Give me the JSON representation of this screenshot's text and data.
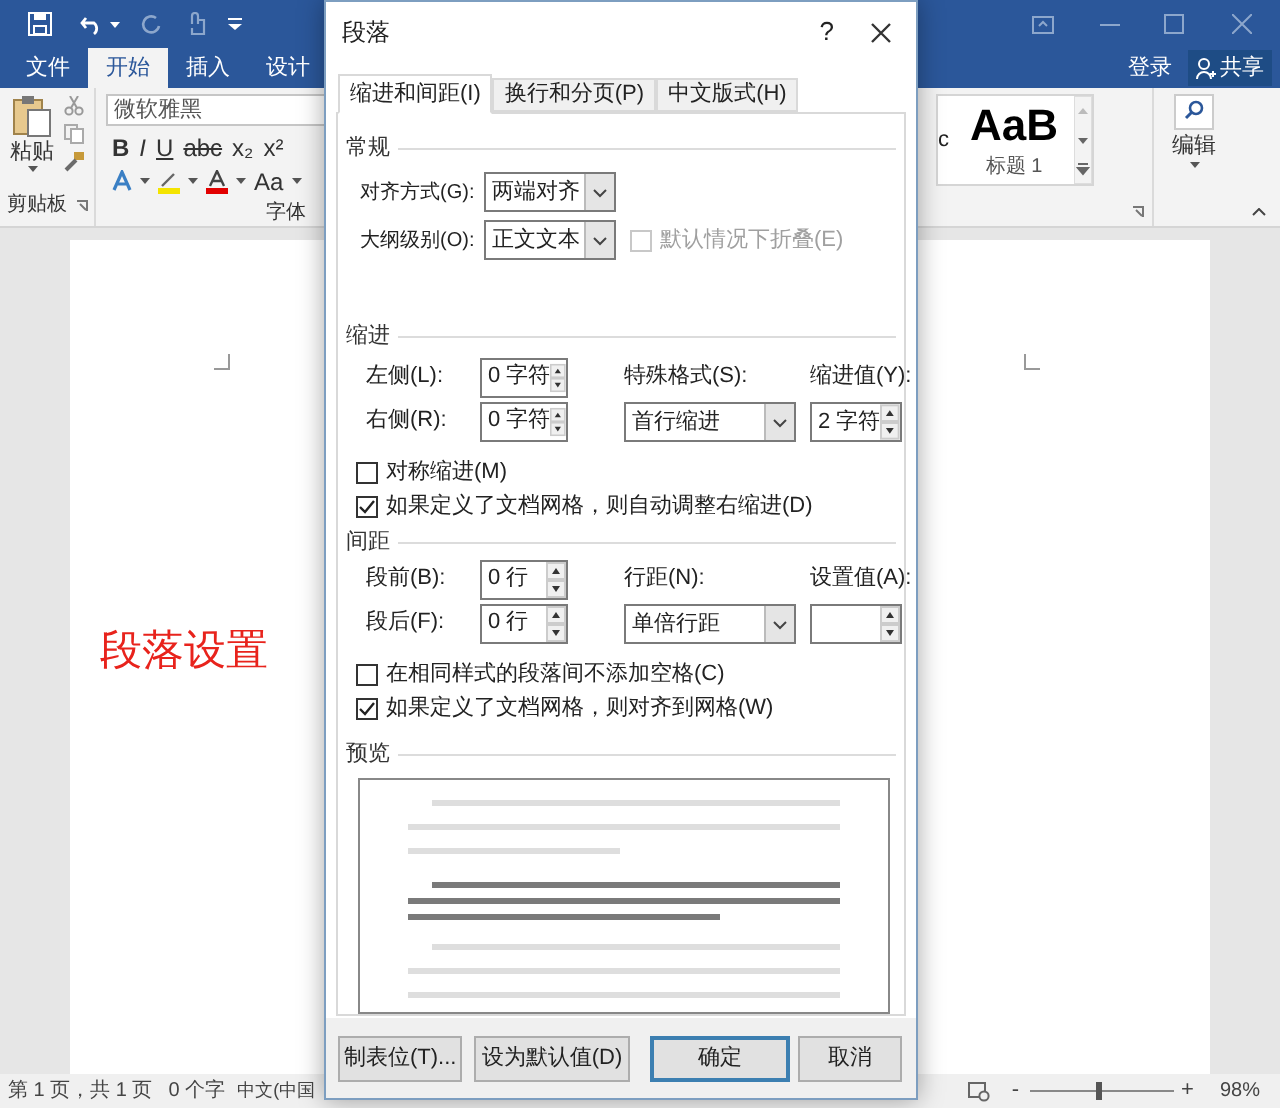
{
  "ribbon_tabs": [
    {
      "label": "文件",
      "selected": false
    },
    {
      "label": "开始",
      "selected": true
    },
    {
      "label": "插入",
      "selected": false
    },
    {
      "label": "设计",
      "selected": false
    }
  ],
  "account": {
    "sign_in": "登录",
    "share": "共享"
  },
  "ribbon": {
    "clipboard": {
      "paste": "粘贴",
      "group": "剪贴板"
    },
    "font": {
      "font_name": "微软雅黑",
      "group": "字体",
      "format_buttons": [
        "B",
        "I",
        "U",
        "abc",
        "x₂",
        "x²"
      ],
      "case_button": "Aa"
    },
    "styles": {
      "partial_sample": "c",
      "sample": "AaB",
      "style_name": "标题 1"
    },
    "editing": {
      "label": "编辑"
    }
  },
  "document": {
    "text": "段落设置"
  },
  "status_bar": {
    "page": "第 1 页，共 1 页",
    "words": "0 个字",
    "language": "中文(中国",
    "zoom_out": "-",
    "zoom_in": "+",
    "zoom": {
      "level": 0.48
    },
    "zoom_text": "98%"
  },
  "dialog": {
    "title": "段落",
    "help": "?",
    "tabs": [
      {
        "label": "缩进和间距(I)",
        "selected": true
      },
      {
        "label": "换行和分页(P)",
        "selected": false
      },
      {
        "label": "中文版式(H)",
        "selected": false
      }
    ],
    "general": {
      "heading": "常规",
      "alignment_label": "对齐方式(G):",
      "alignment": "两端对齐",
      "outline_label": "大纲级别(O):",
      "outline": "正文文本",
      "collapse": {
        "label": "默认情况下折叠(E)",
        "checked": false,
        "disabled": true
      }
    },
    "indent": {
      "heading": "缩进",
      "left_label": "左侧(L):",
      "left": "0 字符",
      "right_label": "右侧(R):",
      "right": "0 字符",
      "special_label": "特殊格式(S):",
      "special": "首行缩进",
      "by_label": "缩进值(Y):",
      "by": "2 字符",
      "checkboxes": [
        {
          "label": "对称缩进(M)",
          "checked": false,
          "disabled": false
        },
        {
          "label": "如果定义了文档网格，则自动调整右缩进(D)",
          "checked": true,
          "disabled": false
        }
      ]
    },
    "spacing": {
      "heading": "间距",
      "before_label": "段前(B):",
      "before": "0 行",
      "after_label": "段后(F):",
      "after": "0 行",
      "line_label": "行距(N):",
      "line": "单倍行距",
      "at_label": "设置值(A):",
      "checkboxes": [
        {
          "label": "在相同样式的段落间不添加空格(C)",
          "checked": false,
          "disabled": false
        },
        {
          "label": "如果定义了文档网格，则对齐到网格(W)",
          "checked": true,
          "disabled": false
        }
      ]
    },
    "preview": {
      "heading": "预览"
    },
    "buttons": [
      {
        "label": "制表位(T)...",
        "default": false
      },
      {
        "label": "设为默认值(D)",
        "default": false
      },
      {
        "label": "确定",
        "default": true
      },
      {
        "label": "取消",
        "default": false
      }
    ]
  }
}
